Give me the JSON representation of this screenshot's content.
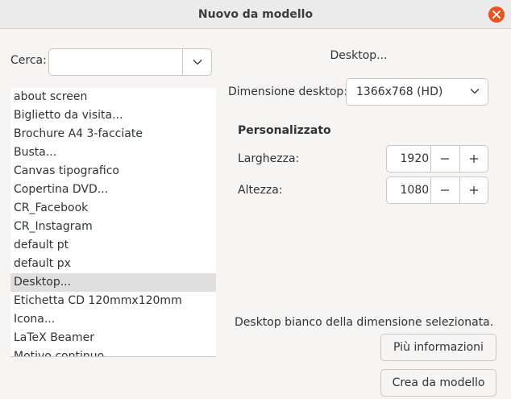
{
  "window": {
    "title": "Nuovo da modello",
    "close_icon": "close-icon",
    "accent_color": "#e95420"
  },
  "search": {
    "label": "Cerca:",
    "value": "",
    "placeholder": ""
  },
  "templates": {
    "selected_index": 10,
    "items": [
      "about screen",
      "Biglietto da visita...",
      "Brochure A4 3-facciate",
      "Busta...",
      "Canvas tipografico",
      "Copertina DVD...",
      "CR_Facebook",
      "CR_Instagram",
      "default pt",
      "default px",
      "Desktop...",
      "Etichetta CD 120mmx120mm",
      "Icona...",
      "LaTeX Beamer",
      "Motivo continuo"
    ]
  },
  "details": {
    "heading": "Desktop...",
    "size_label": "Dimensione desktop:",
    "size_value": "1366x768 (HD)",
    "custom_heading": "Personalizzato",
    "width_label": "Larghezza:",
    "width_value": "1920",
    "height_label": "Altezza:",
    "height_value": "1080",
    "description": "Desktop bianco della dimensione selezionata.",
    "more_info_label": "Più informazioni",
    "create_label": "Crea da modello"
  }
}
